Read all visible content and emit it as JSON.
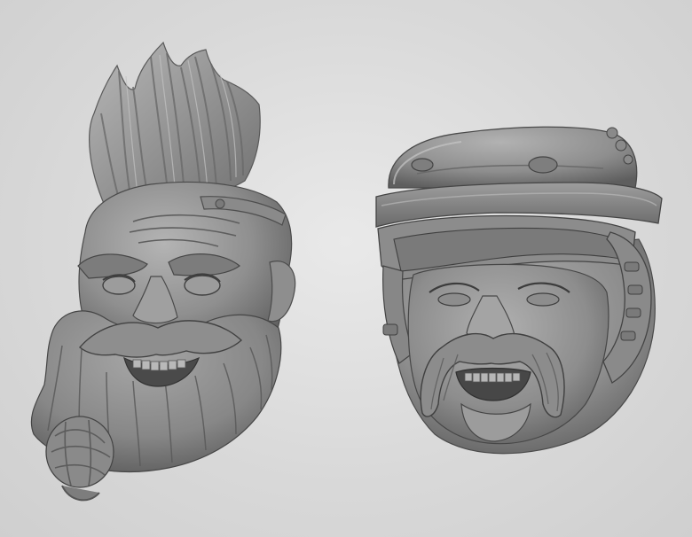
{
  "scene": {
    "subject_left": "mohawk-bearded-dwarf-head-sculpt",
    "subject_right": "helmeted-mustached-dwarf-head-sculpt",
    "colors": {
      "background_light": "#e9e9e9",
      "background_dark": "#cfcfcf",
      "sculpt_light": "#a9a9a9",
      "sculpt_mid": "#8c8c8c",
      "sculpt_dark": "#5c5c5c",
      "sculpt_shadow": "#3f3f3f"
    }
  }
}
